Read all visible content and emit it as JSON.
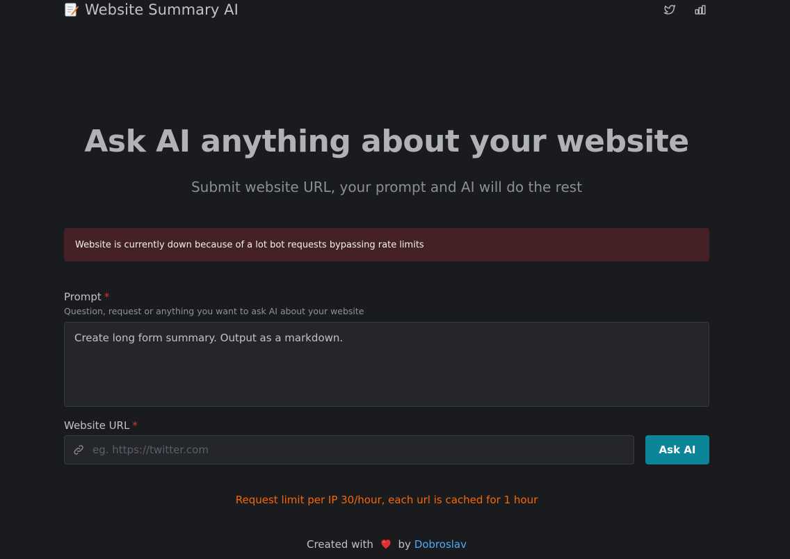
{
  "header": {
    "app_icon": "memo-pencil-icon",
    "title": "Website Summary AI",
    "actions": [
      {
        "icon": "twitter-icon"
      },
      {
        "icon": "bar-chart-icon"
      }
    ]
  },
  "hero": {
    "title": "Ask AI anything about your website",
    "subtitle": "Submit website URL, your prompt and AI will do the rest"
  },
  "alert": {
    "message": "Website is currently down because of a lot bot requests bypassing rate limits",
    "color": "#442124"
  },
  "form": {
    "prompt": {
      "label": "Prompt",
      "required_mark": "*",
      "description": "Question, request or anything you want to ask AI about your website",
      "value": "Create long form summary. Output as a markdown."
    },
    "url": {
      "label": "Website URL",
      "required_mark": "*",
      "icon": "link-icon",
      "placeholder": "eg. https://twitter.com",
      "value": ""
    },
    "submit_label": "Ask AI"
  },
  "limit_note": "Request limit per IP 30/hour, each url is cached for 1 hour",
  "footer": {
    "created_with": "Created with",
    "heart_icon": "heart-icon",
    "by": "by",
    "author": "Dobroslav"
  },
  "colors": {
    "background": "#1a1b1e",
    "accent": "#0c8599",
    "warning": "#f76707",
    "link": "#4dabf7",
    "required": "#e03131"
  }
}
